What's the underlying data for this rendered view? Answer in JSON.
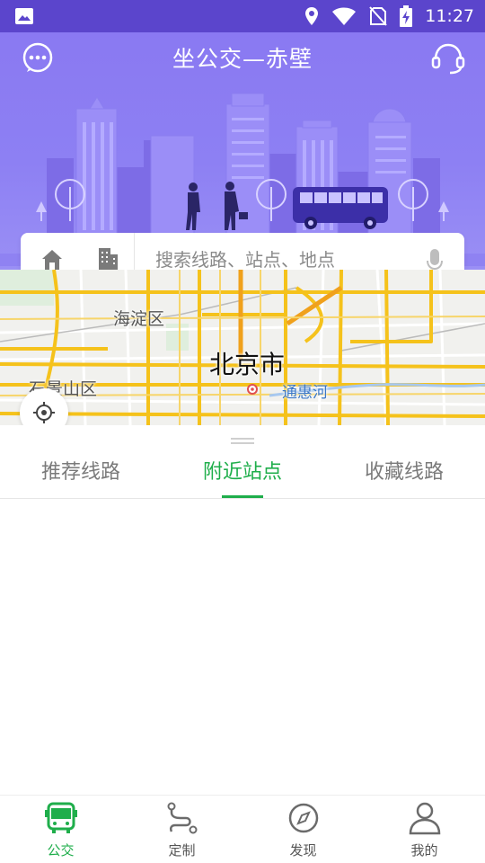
{
  "status_bar": {
    "time": "11:27",
    "icons": [
      "gallery-icon",
      "location-icon",
      "wifi-icon",
      "no-sim-icon",
      "battery-charging-icon"
    ]
  },
  "header": {
    "title": "坐公交—赤壁",
    "left_icon": "chat-bubble-icon",
    "right_icon": "headset-icon"
  },
  "search": {
    "home_icon": "home-icon",
    "company_icon": "building-icon",
    "placeholder": "搜索线路、站点、地点",
    "mic_icon": "microphone-icon"
  },
  "map": {
    "labels": {
      "haidian": "海淀区",
      "city": "北京市",
      "shijingshan": "石景山区",
      "tonghui": "通惠河"
    },
    "locate_icon": "crosshair-icon"
  },
  "tabs": {
    "items": [
      "推荐线路",
      "附近站点",
      "收藏线路"
    ],
    "active": "附近站点"
  },
  "bottom_nav": {
    "items": [
      {
        "label": "公交",
        "icon": "bus-icon",
        "active": true
      },
      {
        "label": "定制",
        "icon": "route-icon",
        "active": false
      },
      {
        "label": "发现",
        "icon": "compass-icon",
        "active": false
      },
      {
        "label": "我的",
        "icon": "user-icon",
        "active": false
      }
    ]
  },
  "colors": {
    "header_purple": "#8a79f2",
    "status_bar": "#5b45cc",
    "accent_green": "#1fae4b"
  }
}
